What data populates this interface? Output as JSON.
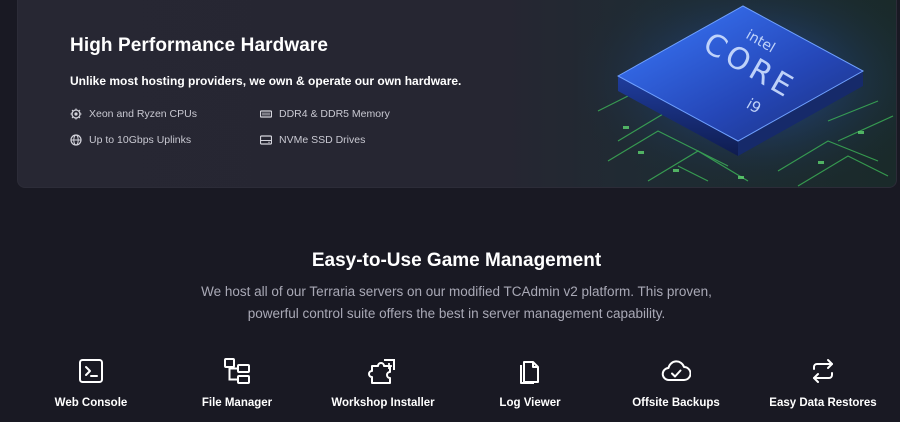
{
  "hardware": {
    "title": "High Performance Hardware",
    "subtitle": "Unlike most hosting providers, we own & operate our own hardware.",
    "features": [
      {
        "label": "Xeon and Ryzen CPUs",
        "icon": "cpu-icon"
      },
      {
        "label": "Up to 10Gbps Uplinks",
        "icon": "globe-icon"
      },
      {
        "label": "DDR4 & DDR5 Memory",
        "icon": "memory-icon"
      },
      {
        "label": "NVMe SSD Drives",
        "icon": "drive-icon"
      }
    ],
    "chip": {
      "brand": "intel",
      "line": "CORE",
      "tier": "i9"
    }
  },
  "management": {
    "title": "Easy-to-Use Game Management",
    "description": "We host all of our Terraria servers on our modified TCAdmin v2 platform. This proven, powerful control suite offers the best in server management capability.",
    "tools": [
      {
        "label": "Web Console",
        "icon": "terminal-icon"
      },
      {
        "label": "File Manager",
        "icon": "folder-tree-icon"
      },
      {
        "label": "Workshop Installer",
        "icon": "puzzle-icon"
      },
      {
        "label": "Log Viewer",
        "icon": "document-icon"
      },
      {
        "label": "Offsite Backups",
        "icon": "cloud-check-icon"
      },
      {
        "label": "Easy Data Restores",
        "icon": "refresh-icon"
      }
    ]
  },
  "colors": {
    "background": "#191923",
    "card": "#272733",
    "text": "#ffffff",
    "muted": "#a9a9b6",
    "chip_blue": "#2b5fd9",
    "circuit_green": "#3fbf5a"
  }
}
